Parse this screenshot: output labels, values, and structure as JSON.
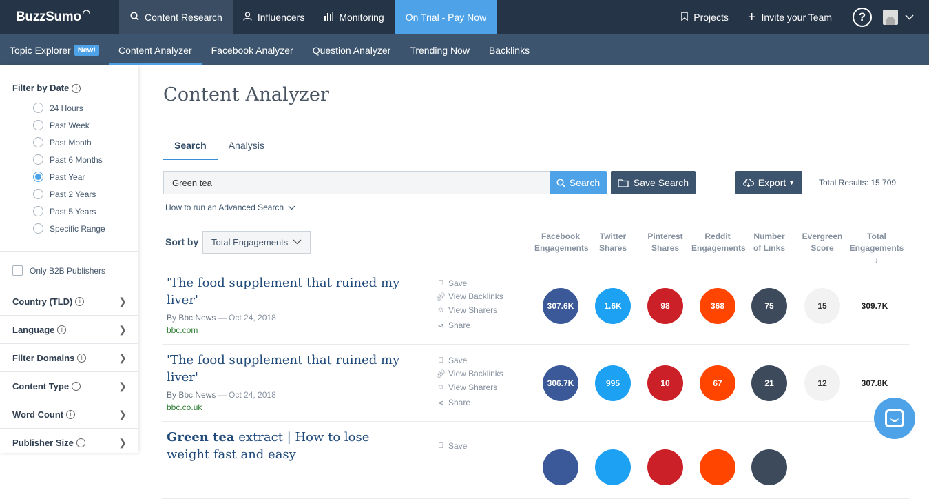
{
  "topnav": {
    "logo": "BuzzSumo",
    "items": [
      {
        "label": "Content Research",
        "icon": "search-icon"
      },
      {
        "label": "Influencers",
        "icon": "user-icon"
      },
      {
        "label": "Monitoring",
        "icon": "bar-chart-icon"
      }
    ],
    "trial": "On Trial - Pay Now",
    "projects": "Projects",
    "invite": "Invite your Team",
    "help": "?"
  },
  "subnav": {
    "items": [
      "Topic Explorer",
      "Content Analyzer",
      "Facebook Analyzer",
      "Question Analyzer",
      "Trending Now",
      "Backlinks"
    ],
    "new_badge": "New!",
    "active": "Content Analyzer"
  },
  "sidebar": {
    "filter_title": "Filter by Date",
    "date_options": [
      "24 Hours",
      "Past Week",
      "Past Month",
      "Past 6 Months",
      "Past Year",
      "Past 2 Years",
      "Past 5 Years",
      "Specific Range"
    ],
    "selected_date": "Past Year",
    "b2b": "Only B2B Publishers",
    "sections": [
      "Country (TLD)",
      "Language",
      "Filter Domains",
      "Content Type",
      "Word Count",
      "Publisher Size"
    ]
  },
  "main": {
    "title": "Content Analyzer",
    "tabs": [
      "Search",
      "Analysis"
    ],
    "search_value": "Green tea",
    "search_btn": "Search",
    "save_btn": "Save Search",
    "export_btn": "Export",
    "total_results": "Total Results: 15,709",
    "advanced_link": "How to run an Advanced Search",
    "sort_label": "Sort by",
    "sort_value": "Total Engagements",
    "columns": [
      [
        "Facebook",
        "Engagements"
      ],
      [
        "Twitter",
        "Shares"
      ],
      [
        "Pinterest",
        "Shares"
      ],
      [
        "Reddit",
        "Engagements"
      ],
      [
        "Number",
        "of Links"
      ],
      [
        "Evergreen",
        "Score"
      ],
      [
        "Total",
        "Engagements"
      ]
    ],
    "actions": [
      "Save",
      "View Backlinks",
      "View Sharers",
      "Share"
    ],
    "rows": [
      {
        "title": "'The food supplement that ruined my liver'",
        "author": "By Bbc News",
        "date": "Oct 24, 2018",
        "domain": "bbc.com",
        "values": [
          "307.6K",
          "1.6K",
          "98",
          "368",
          "75",
          "15",
          "309.7K"
        ]
      },
      {
        "title": "'The food supplement that ruined my liver'",
        "author": "By Bbc News",
        "date": "Oct 24, 2018",
        "domain": "bbc.co.uk",
        "values": [
          "306.7K",
          "995",
          "10",
          "67",
          "21",
          "12",
          "307.8K"
        ]
      },
      {
        "title_bold": "Green tea",
        "title_rest": " extract | How to lose weight fast and easy"
      }
    ]
  },
  "colors": {
    "topnav": "#253447",
    "subnav": "#3c546d",
    "accent": "#4da2e8",
    "facebook": "#3b5998",
    "twitter": "#1da1f2",
    "pinterest": "#cb2027",
    "reddit": "#ff4500",
    "links": "#3c4a5c",
    "evergreen": "#f2f2f2"
  }
}
